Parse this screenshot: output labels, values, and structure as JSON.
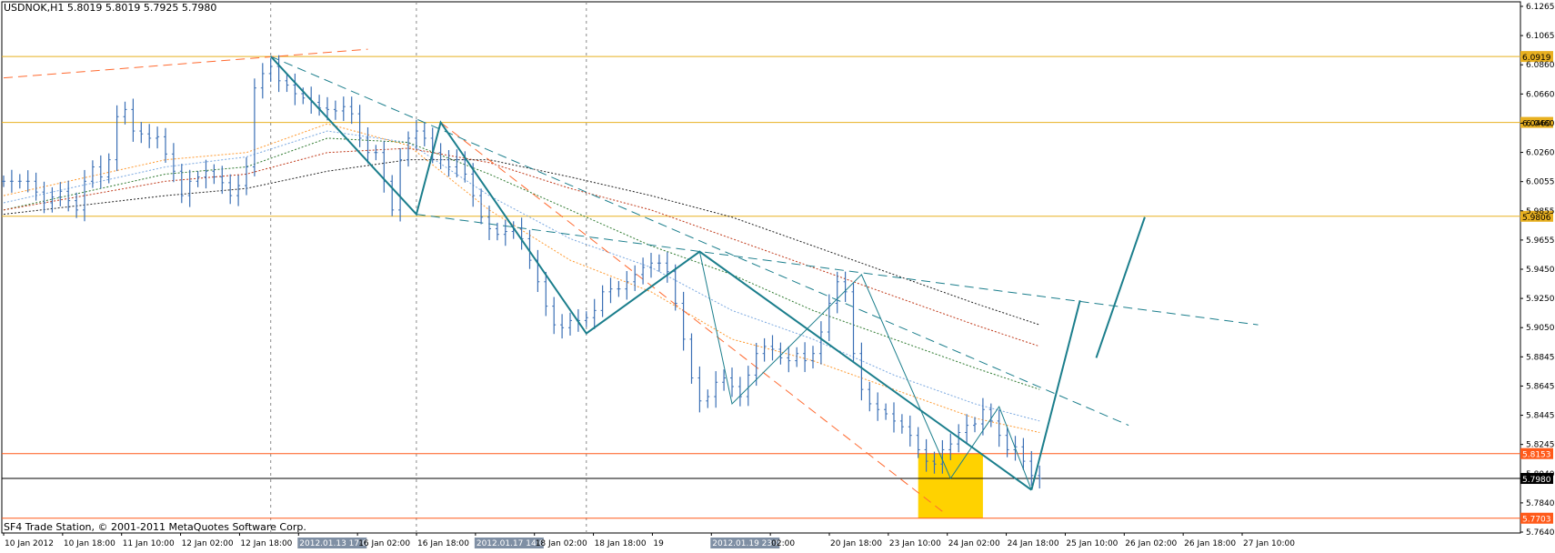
{
  "header": {
    "symbol": "USDNOK,H1",
    "ohlc": "5.8019 5.8019 5.7925 5.7980"
  },
  "footer": {
    "copyright": "SF4 Trade Station, © 2001-2011 MetaQuotes Software Corp."
  },
  "colors": {
    "bar": "#3a6fb5",
    "wave": "#1b7e8c",
    "hline_gold": "#e8b020",
    "hline_red": "#ff5a1a",
    "ma_orange": "#ff9a30",
    "ma_blue": "#7aa8e0",
    "ma_green": "#2f7a30",
    "ma_red": "#c03a1a",
    "ma_black": "#222222",
    "zone": "#ffd200",
    "trend_red": "#ff6a30"
  },
  "chart_data": {
    "type": "candlestick",
    "instrument": "USDNOK",
    "timeframe": "H1",
    "ylim": [
      5.76,
      6.13
    ],
    "y_ticks": [
      "6.1265",
      "6.1065",
      "6.0860",
      "6.0660",
      "6.0460",
      "6.0260",
      "6.0055",
      "5.9855",
      "5.9655",
      "5.9450",
      "5.9250",
      "5.9050",
      "5.8845",
      "5.8645",
      "5.8445",
      "5.8245",
      "5.8040",
      "5.7840",
      "5.7640"
    ],
    "x_ticks": [
      "10 Jan 2012",
      "10 Jan 18:00",
      "11 Jan 10:00",
      "12 Jan 02:00",
      "12 Jan 18:00",
      "2012.01.13 17:00",
      "16 Jan 02:00",
      "16 Jan 18:00",
      "2012.01.17 14:00",
      "18 Jan 02:00",
      "18 Jan 18:00",
      "19",
      "2012.01.19 23:00",
      "02:00",
      "20 Jan 18:00",
      "23 Jan 10:00",
      "24 Jan 02:00",
      "24 Jan 18:00",
      "25 Jan 10:00",
      "26 Jan 02:00",
      "26 Jan 18:00",
      "27 Jan 10:00"
    ],
    "highlighted_time_labels": [
      "2012.01.13 17:00",
      "2012.01.17 14:00",
      "2012.01.19 23:00"
    ],
    "price_levels": [
      {
        "value": 6.0919,
        "label": "6.0919",
        "kind": "gold"
      },
      {
        "value": 6.046,
        "label": "6.0460",
        "kind": "gold"
      },
      {
        "value": 5.9806,
        "label": "5.9806",
        "kind": "gold"
      },
      {
        "value": 5.8153,
        "label": "5.8153",
        "kind": "red"
      },
      {
        "value": 5.7703,
        "label": "5.7703",
        "kind": "red"
      }
    ],
    "current_price": {
      "value": 5.798,
      "label": "5.7980"
    },
    "price_path": [
      [
        0,
        6.005
      ],
      [
        3,
        6.005
      ],
      [
        5,
        5.99
      ],
      [
        7,
        5.998
      ],
      [
        9,
        5.985
      ],
      [
        10,
        6.005
      ],
      [
        11,
        6.015
      ],
      [
        12,
        6.008
      ],
      [
        13,
        6.02
      ],
      [
        14,
        6.05
      ],
      [
        15,
        6.055
      ],
      [
        16,
        6.04
      ],
      [
        17,
        6.038
      ],
      [
        18,
        6.035
      ],
      [
        19,
        6.036
      ],
      [
        20,
        6.024
      ],
      [
        21,
        6.012
      ],
      [
        22,
        5.995
      ],
      [
        23,
        6.005
      ],
      [
        24,
        6.008
      ],
      [
        25,
        6.012
      ],
      [
        26,
        6.008
      ],
      [
        27,
        6.004
      ],
      [
        28,
        5.995
      ],
      [
        29,
        6.002
      ],
      [
        30,
        6.015
      ],
      [
        31,
        6.07
      ],
      [
        32,
        6.08
      ],
      [
        33,
        6.085
      ],
      [
        34,
        6.075
      ],
      [
        35,
        6.072
      ],
      [
        36,
        6.066
      ],
      [
        37,
        6.063
      ],
      [
        38,
        6.06
      ],
      [
        39,
        6.056
      ],
      [
        40,
        6.055
      ],
      [
        41,
        6.054
      ],
      [
        42,
        6.057
      ],
      [
        43,
        6.052
      ],
      [
        44,
        6.035
      ],
      [
        45,
        6.025
      ],
      [
        46,
        6.025
      ],
      [
        47,
        6.005
      ],
      [
        48,
        5.985
      ],
      [
        49,
        6.02
      ],
      [
        50,
        6.035
      ],
      [
        51,
        6.04
      ],
      [
        52,
        6.035
      ],
      [
        53,
        6.025
      ],
      [
        54,
        6.02
      ],
      [
        55,
        6.015
      ],
      [
        56,
        6.02
      ],
      [
        57,
        6.01
      ],
      [
        58,
        5.995
      ],
      [
        59,
        5.98
      ],
      [
        60,
        5.972
      ],
      [
        61,
        5.968
      ],
      [
        62,
        5.97
      ],
      [
        63,
        5.972
      ],
      [
        64,
        5.965
      ],
      [
        65,
        5.95
      ],
      [
        66,
        5.935
      ],
      [
        67,
        5.918
      ],
      [
        68,
        5.905
      ],
      [
        69,
        5.903
      ],
      [
        70,
        5.908
      ],
      [
        71,
        5.908
      ],
      [
        72,
        5.91
      ],
      [
        73,
        5.915
      ],
      [
        74,
        5.928
      ],
      [
        75,
        5.93
      ],
      [
        76,
        5.93
      ],
      [
        77,
        5.935
      ],
      [
        78,
        5.94
      ],
      [
        79,
        5.945
      ],
      [
        80,
        5.948
      ],
      [
        81,
        5.948
      ],
      [
        82,
        5.942
      ],
      [
        83,
        5.92
      ],
      [
        84,
        5.895
      ],
      [
        85,
        5.868
      ],
      [
        86,
        5.852
      ],
      [
        87,
        5.855
      ],
      [
        88,
        5.865
      ],
      [
        89,
        5.868
      ],
      [
        90,
        5.862
      ],
      [
        91,
        5.855
      ],
      [
        92,
        5.87
      ],
      [
        93,
        5.885
      ],
      [
        94,
        5.89
      ],
      [
        95,
        5.888
      ],
      [
        96,
        5.882
      ],
      [
        97,
        5.88
      ],
      [
        98,
        5.885
      ],
      [
        99,
        5.88
      ],
      [
        100,
        5.885
      ],
      [
        101,
        5.9
      ],
      [
        102,
        5.92
      ],
      [
        103,
        5.935
      ],
      [
        104,
        5.928
      ],
      [
        105,
        5.885
      ],
      [
        106,
        5.86
      ],
      [
        107,
        5.85
      ],
      [
        108,
        5.846
      ],
      [
        109,
        5.843
      ],
      [
        110,
        5.838
      ],
      [
        111,
        5.834
      ],
      [
        112,
        5.828
      ],
      [
        113,
        5.818
      ],
      [
        114,
        5.81
      ],
      [
        115,
        5.808
      ],
      [
        116,
        5.818
      ],
      [
        117,
        5.822
      ],
      [
        118,
        5.83
      ],
      [
        119,
        5.835
      ],
      [
        120,
        5.836
      ],
      [
        121,
        5.846
      ],
      [
        122,
        5.838
      ],
      [
        123,
        5.828
      ],
      [
        124,
        5.818
      ],
      [
        125,
        5.82
      ],
      [
        126,
        5.81
      ],
      [
        127,
        5.8
      ],
      [
        128,
        5.798
      ]
    ],
    "moving_averages": [
      {
        "color_key": "ma_orange",
        "points": [
          [
            0,
            5.995
          ],
          [
            20,
            6.02
          ],
          [
            30,
            6.025
          ],
          [
            40,
            6.045
          ],
          [
            50,
            6.03
          ],
          [
            60,
            5.985
          ],
          [
            70,
            5.95
          ],
          [
            80,
            5.928
          ],
          [
            90,
            5.895
          ],
          [
            100,
            5.88
          ],
          [
            110,
            5.86
          ],
          [
            120,
            5.84
          ],
          [
            128,
            5.83
          ]
        ]
      },
      {
        "color_key": "ma_blue",
        "points": [
          [
            0,
            5.99
          ],
          [
            20,
            6.015
          ],
          [
            30,
            6.022
          ],
          [
            40,
            6.04
          ],
          [
            50,
            6.032
          ],
          [
            60,
            5.995
          ],
          [
            70,
            5.965
          ],
          [
            80,
            5.945
          ],
          [
            90,
            5.915
          ],
          [
            100,
            5.895
          ],
          [
            110,
            5.87
          ],
          [
            120,
            5.85
          ],
          [
            128,
            5.838
          ]
        ]
      },
      {
        "color_key": "ma_green",
        "points": [
          [
            0,
            5.985
          ],
          [
            20,
            6.01
          ],
          [
            30,
            6.015
          ],
          [
            40,
            6.035
          ],
          [
            50,
            6.032
          ],
          [
            60,
            6.01
          ],
          [
            70,
            5.985
          ],
          [
            80,
            5.96
          ],
          [
            90,
            5.94
          ],
          [
            100,
            5.915
          ],
          [
            110,
            5.895
          ],
          [
            120,
            5.875
          ],
          [
            128,
            5.86
          ]
        ]
      },
      {
        "color_key": "ma_red",
        "points": [
          [
            0,
            5.985
          ],
          [
            20,
            6.005
          ],
          [
            30,
            6.01
          ],
          [
            40,
            6.025
          ],
          [
            50,
            6.028
          ],
          [
            60,
            6.018
          ],
          [
            70,
            6.0
          ],
          [
            80,
            5.985
          ],
          [
            90,
            5.965
          ],
          [
            100,
            5.945
          ],
          [
            110,
            5.925
          ],
          [
            120,
            5.905
          ],
          [
            128,
            5.89
          ]
        ]
      },
      {
        "color_key": "ma_black",
        "points": [
          [
            0,
            5.982
          ],
          [
            20,
            5.995
          ],
          [
            30,
            6.0
          ],
          [
            40,
            6.012
          ],
          [
            50,
            6.02
          ],
          [
            60,
            6.02
          ],
          [
            70,
            6.008
          ],
          [
            80,
            5.995
          ],
          [
            90,
            5.98
          ],
          [
            100,
            5.96
          ],
          [
            110,
            5.94
          ],
          [
            120,
            5.92
          ],
          [
            128,
            5.905
          ]
        ]
      }
    ],
    "wave_lines": [
      {
        "points": [
          [
            33,
            6.092
          ],
          [
            51,
            5.982
          ],
          [
            54,
            6.046
          ],
          [
            72,
            5.899
          ],
          [
            86,
            5.956
          ],
          [
            127,
            5.79
          ]
        ],
        "width": 2
      },
      {
        "points": [
          [
            86,
            5.956
          ],
          [
            90,
            5.85
          ],
          [
            106,
            5.94
          ],
          [
            117,
            5.798
          ],
          [
            123,
            5.848
          ],
          [
            127,
            5.79
          ]
        ],
        "width": 1
      },
      {
        "points": [
          [
            127,
            5.79
          ],
          [
            133,
            5.922
          ]
        ],
        "width": 2
      },
      {
        "points": [
          [
            135,
            5.882
          ],
          [
            141,
            5.98
          ]
        ],
        "width": 2
      }
    ],
    "trend_lines": [
      {
        "kind": "dash_teal",
        "points": [
          [
            33,
            6.092
          ],
          [
            139,
            5.835
          ]
        ]
      },
      {
        "kind": "dash_teal",
        "points": [
          [
            51,
            5.982
          ],
          [
            155,
            5.905
          ]
        ]
      },
      {
        "kind": "dash_red",
        "points": [
          [
            54,
            6.046
          ],
          [
            116,
            5.775
          ]
        ]
      },
      {
        "kind": "dash_red",
        "points": [
          [
            0,
            6.077
          ],
          [
            45,
            6.097
          ]
        ]
      }
    ],
    "demand_zone": {
      "from": 113,
      "to": 121,
      "top": 5.8153,
      "bottom": 5.7703
    },
    "vertical_markers": [
      33,
      51,
      72
    ]
  }
}
